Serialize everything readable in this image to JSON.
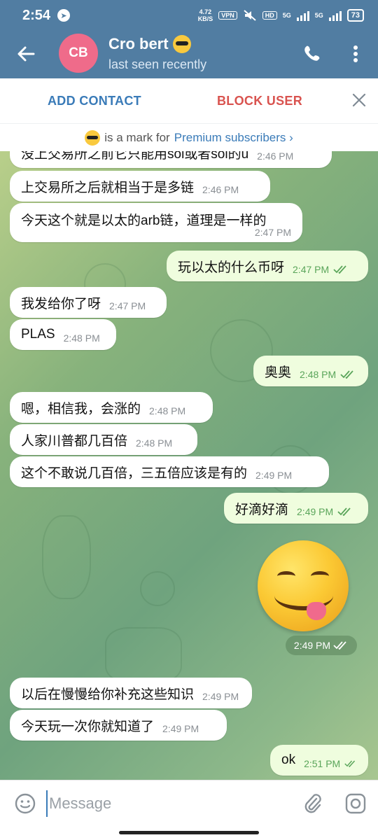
{
  "status_bar": {
    "time": "2:54",
    "net_speed_value": "4.72",
    "net_speed_unit": "KB/S",
    "vpn": "VPN",
    "hd": "HD",
    "battery": "73",
    "signal_labels": [
      "5G",
      "5G"
    ]
  },
  "header": {
    "avatar_initials": "CB",
    "name": "Cro bert",
    "status": "last seen recently",
    "colors": {
      "bar": "#517da2",
      "avatar": "#ef6b8a"
    }
  },
  "action_bar": {
    "add_contact": "ADD CONTACT",
    "block_user": "BLOCK USER"
  },
  "premium_notice": {
    "text": "is a mark for",
    "link": "Premium subscribers ›"
  },
  "messages": [
    {
      "dir": "in",
      "text": "没上交易所之前它只能用sol或者sol的u",
      "time": "2:46 PM"
    },
    {
      "dir": "in",
      "text": "上交易所之后就相当于是多链",
      "time": "2:46 PM"
    },
    {
      "dir": "in",
      "text": "今天这个就是以太的arb链，道理是一样的",
      "time": "2:47 PM"
    },
    {
      "dir": "out",
      "text": "玩以太的什么币呀",
      "time": "2:47 PM"
    },
    {
      "dir": "in",
      "text": "我发给你了呀",
      "time": "2:47 PM"
    },
    {
      "dir": "in",
      "text": "PLAS",
      "time": "2:48 PM"
    },
    {
      "dir": "out",
      "text": "奥奥",
      "time": "2:48 PM"
    },
    {
      "dir": "in",
      "text": "嗯，相信我，会涨的",
      "time": "2:48 PM"
    },
    {
      "dir": "in",
      "text": "人家川普都几百倍",
      "time": "2:48 PM"
    },
    {
      "dir": "in",
      "text": "这个不敢说几百倍，三五倍应该是有的",
      "time": "2:49 PM"
    },
    {
      "dir": "out",
      "text": "好滴好滴",
      "time": "2:49 PM"
    },
    {
      "dir": "in",
      "text": "以后在慢慢给你补充这些知识",
      "time": "2:49 PM"
    },
    {
      "dir": "in",
      "text": "今天玩一次你就知道了",
      "time": "2:49 PM"
    },
    {
      "dir": "out",
      "text": "ok",
      "time": "2:51 PM"
    }
  ],
  "sticker": {
    "emoji": "face-savoring-food",
    "time": "2:49 PM"
  },
  "input": {
    "placeholder": "Message"
  }
}
